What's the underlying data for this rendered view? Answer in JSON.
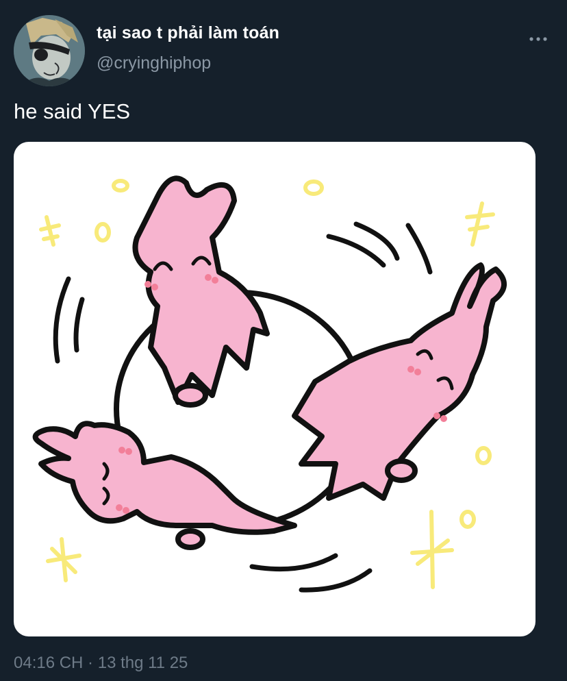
{
  "author": {
    "display_name": "tại sao t phải làm toán",
    "handle": "@cryinghiphop"
  },
  "icons": {
    "more": "more-horizontal-icon"
  },
  "tweet": {
    "text": "he said YES",
    "timestamp": "04:16 CH · 13 thg 11 25"
  },
  "colors": {
    "background": "#15202b",
    "secondary_text": "#8b98a5",
    "bunny_pink": "#f7b4cf",
    "sparkle_yellow": "#f8ea7a"
  }
}
